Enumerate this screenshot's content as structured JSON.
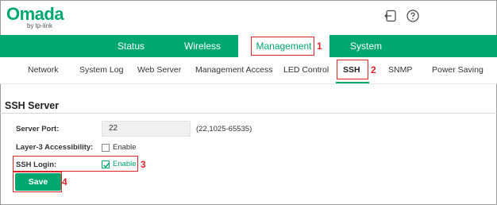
{
  "brand": {
    "name": "Omada",
    "byline": "by tp-link"
  },
  "header_icons": [
    "logout-icon",
    "help-icon"
  ],
  "main_nav": {
    "status": "Status",
    "wireless": "Wireless",
    "management": "Management",
    "system": "System",
    "active": "Management"
  },
  "sub_nav": {
    "network": "Network",
    "system_log": "System Log",
    "web_server": "Web Server",
    "management_access": "Management Access",
    "led_control": "LED Control",
    "ssh": "SSH",
    "snmp": "SNMP",
    "power_saving": "Power Saving",
    "active": "SSH"
  },
  "section": {
    "title": "SSH Server"
  },
  "form": {
    "server_port_label": "Server Port:",
    "server_port_value": "22",
    "server_port_range": "(22,1025-65535)",
    "l3_label": "Layer-3 Accessibility:",
    "l3_enable_label": "Enable",
    "l3_checked": false,
    "ssh_login_label": "SSH Login:",
    "ssh_enable_label": "Enable",
    "ssh_checked": true
  },
  "save_label": "Save",
  "annotations": {
    "n1": "1",
    "n2": "2",
    "n3": "3",
    "n4": "4"
  },
  "colors": {
    "accent": "#00a870",
    "annotation": "#e0232b"
  }
}
